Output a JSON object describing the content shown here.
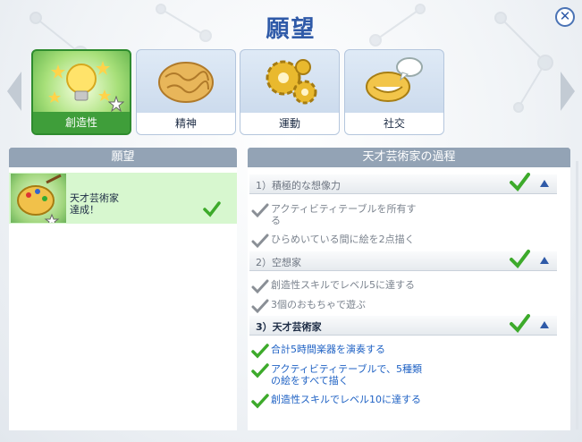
{
  "window": {
    "title": "願望",
    "close_label": "✕"
  },
  "tabs": [
    {
      "label": "創造性",
      "icon": "lightbulb-icon",
      "active": true
    },
    {
      "label": "精神",
      "icon": "brain-icon",
      "active": false
    },
    {
      "label": "運動",
      "icon": "gears-icon",
      "active": false
    },
    {
      "label": "社交",
      "icon": "speech-mouth-icon",
      "active": false
    }
  ],
  "left_panel": {
    "header": "願望",
    "aspiration": {
      "name": "天才芸術家",
      "status": "達成！",
      "icon": "palette-icon"
    }
  },
  "right_panel": {
    "header": "天才芸術家の過程",
    "milestones": [
      {
        "label": "1）積極的な想像力",
        "goals": [
          "アクティビティテーブルを所有す\nる",
          "ひらめいている間に絵を2点描く"
        ]
      },
      {
        "label": "2）空想家",
        "goals": [
          "創造性スキルでレベル5に達する",
          "3個のおもちゃで遊ぶ"
        ]
      },
      {
        "label": "3）天才芸術家",
        "goals": [
          "合計5時間楽器を演奏する",
          "アクティビティテーブルで、5種類\nの絵をすべて描く",
          "創造性スキルでレベル10に達する"
        ]
      }
    ]
  },
  "colors": {
    "accent_blue": "#2f5aa8",
    "check_green": "#3daa2b",
    "current_goal_blue": "#1f62c4",
    "active_tab_green": "#3f9e3a"
  }
}
